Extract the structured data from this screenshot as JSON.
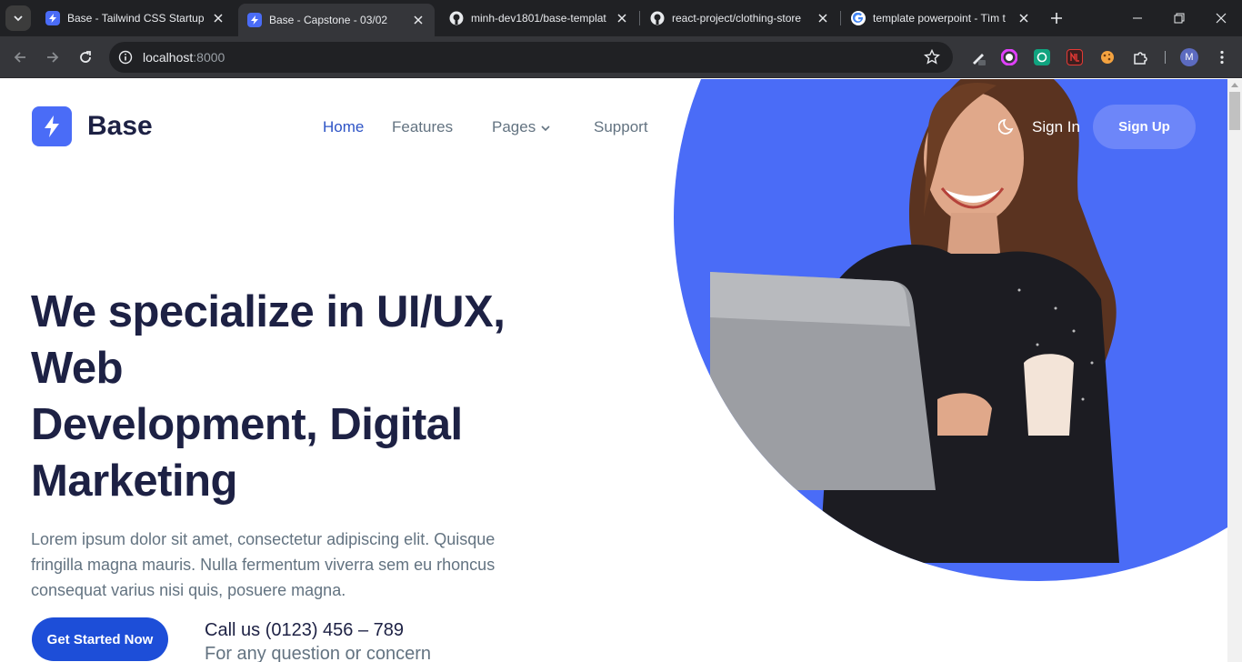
{
  "browser": {
    "tabs": [
      {
        "title": "Base - Tailwind CSS Startup T",
        "favicon": "bolt-favicon",
        "active": false
      },
      {
        "title": "Base - Capstone - 03/02",
        "favicon": "bolt-favicon",
        "active": true
      },
      {
        "title": "minh-dev1801/base-templat",
        "favicon": "github-favicon",
        "active": false
      },
      {
        "title": "react-project/clothing-store",
        "favicon": "github-favicon",
        "active": false
      },
      {
        "title": "template powerpoint - Tìm t",
        "favicon": "google-favicon",
        "active": false
      }
    ],
    "url_host": "localhost",
    "url_port": ":8000",
    "profile_initial": "M"
  },
  "site": {
    "brand": "Base",
    "nav": {
      "home": "Home",
      "features": "Features",
      "pages": "Pages",
      "support": "Support"
    },
    "sign_in": "Sign In",
    "sign_up": "Sign Up"
  },
  "hero": {
    "headline_lines": [
      "We specialize in UI/UX,",
      "Web",
      "Development, Digital",
      "Marketing"
    ],
    "description": "Lorem ipsum dolor sit amet, consectetur adipiscing elit. Quisque fringilla magna mauris. Nulla fermentum viverra sem eu rhoncus consequat varius nisi quis, posuere magna.",
    "cta": "Get Started Now",
    "call": "Call us (0123) 456 – 789",
    "call_sub": "For any question or concern"
  },
  "colors": {
    "primary": "#4a6cf7",
    "dark_text": "#1d2144",
    "body_text": "#637381",
    "cta": "#1d4ed8"
  }
}
